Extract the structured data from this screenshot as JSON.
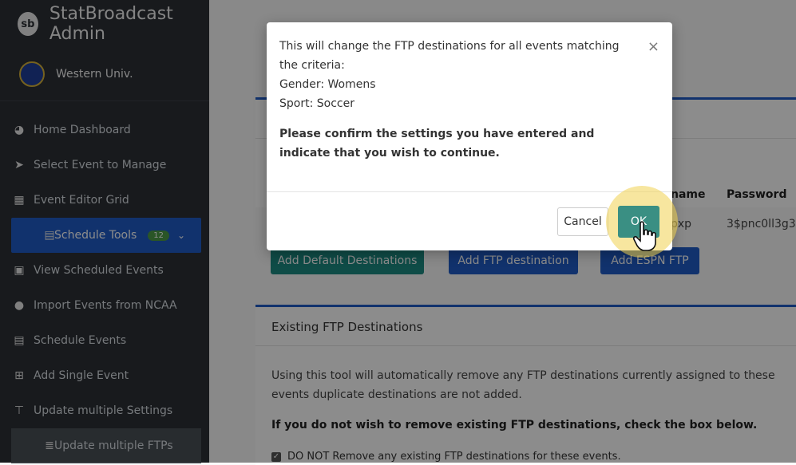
{
  "sidebar": {
    "brand_logo": "sb",
    "brand": "StatBroadcast Admin",
    "org": "Western Univ.",
    "items": [
      {
        "label": "Home Dashboard",
        "icon": "dashboard-icon"
      },
      {
        "label": "Select Event to Manage",
        "icon": "pointer-icon"
      },
      {
        "label": "Event Editor Grid",
        "icon": "grid-icon"
      },
      {
        "label": "Schedule Tools",
        "icon": "calendar-icon",
        "badge": "12"
      },
      {
        "label": "View Scheduled Events",
        "icon": "calendar-check-icon"
      },
      {
        "label": "Import Events from NCAA",
        "icon": "import-icon"
      },
      {
        "label": "Schedule Events",
        "icon": "calendar-icon"
      },
      {
        "label": "Add Single Event",
        "icon": "plus-square-icon"
      },
      {
        "label": "Update multiple Settings",
        "icon": "sitemap-icon"
      },
      {
        "label": "Update multiple FTPs",
        "icon": "server-icon"
      }
    ]
  },
  "table": {
    "headers": {
      "username": "name",
      "password": "Password"
    },
    "row": {
      "username": "pxp",
      "password": "3$pnc0ll3g3"
    }
  },
  "buttons": {
    "add_default": "Add Default Destinations",
    "add_ftp": "Add FTP destination",
    "add_espn": "Add ESPN FTP"
  },
  "existing": {
    "title": "Existing FTP Destinations",
    "description": "Using this tool will automatically remove any FTP destinations currently assigned to these events duplicate destinations are not added.",
    "warning": "If you do not wish to remove existing FTP destinations, check the box below.",
    "checkbox_label": "DO NOT Remove any existing FTP destinations for these events.",
    "checkbox_checked": true
  },
  "modal": {
    "line1": "This will change the FTP destinations for all events matching the criteria:",
    "gender": "Gender: Womens",
    "sport": "Sport: Soccer",
    "confirm": "Please confirm the settings you have entered and indicate that you wish to continue.",
    "cancel": "Cancel",
    "ok": "OK",
    "close": "×"
  },
  "colors": {
    "sidebar_bg": "#2c3136",
    "accent_blue": "#1f5cc6",
    "teal": "#1c8a82",
    "badge_green": "#4d9c48",
    "highlight": "#f0d250"
  }
}
